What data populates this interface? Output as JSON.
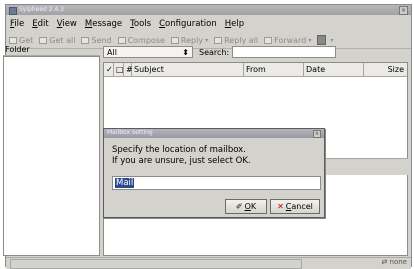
{
  "window": {
    "title": "Sylpheed 2.4.3"
  },
  "menubar": {
    "items": [
      "File",
      "Edit",
      "View",
      "Message",
      "Tools",
      "Configuration",
      "Help"
    ]
  },
  "toolbar": {
    "get": "Get",
    "get_all": "Get all",
    "send": "Send",
    "compose": "Compose",
    "reply": "Reply",
    "reply_all": "Reply all",
    "forward": "Forward"
  },
  "folder_pane": {
    "header": "Folder"
  },
  "filter": {
    "selected": "All",
    "search_label": "Search:",
    "search_value": ""
  },
  "message_list": {
    "columns": [
      "✓",
      "□",
      "#",
      "Subject",
      "From",
      "Date",
      "Size"
    ]
  },
  "dialog": {
    "title": "Mailbox setting",
    "message_line1": "Specify the location of mailbox.",
    "message_line2": "If you are unsure, just select OK.",
    "input_value": "Mail",
    "ok_label": "OK",
    "cancel_label": "Cancel"
  },
  "statusbar": {
    "online_text": "none"
  }
}
